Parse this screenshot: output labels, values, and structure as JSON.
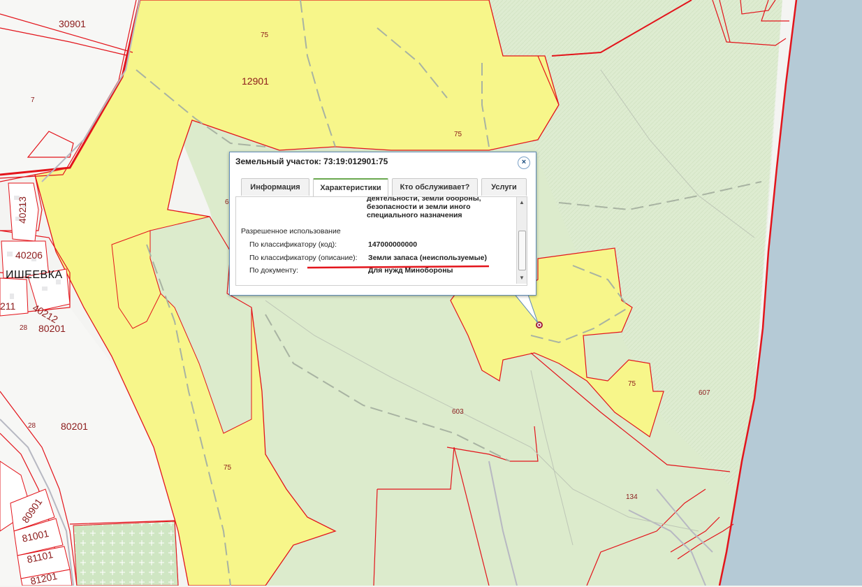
{
  "map": {
    "colors": {
      "background": "#f4f4f2",
      "green_area": "#dcebcc",
      "parcel_fill": "#f7f68a",
      "parcel_border": "#e3141b",
      "road": "#b5b5bb",
      "water": "#b5cad6",
      "park_green": "#cfe6c3"
    },
    "labels": {
      "l30901": "30901",
      "l12901": "12901",
      "l75a": "75",
      "l75b": "75",
      "l75c": "75",
      "l75d": "75",
      "l7": "7",
      "l40213": "40213",
      "l40206": "40206",
      "l40212": "40212",
      "l211": "211",
      "l28a": "28",
      "l80201a": "80201",
      "l28b": "28",
      "l80201b": "80201",
      "l603": "603",
      "l607": "607",
      "l134": "134",
      "l80901": "80901",
      "l81001": "81001",
      "l81101": "81101",
      "l81201": "81201",
      "l6": "6",
      "village": "ИШЕЕВКА"
    }
  },
  "popup": {
    "title": "Земельный участок: 73:19:012901:75",
    "close_symbol": "×",
    "tabs": [
      {
        "label": "Информация",
        "active": false
      },
      {
        "label": "Характеристики",
        "active": true
      },
      {
        "label": "Кто обслуживает?",
        "active": false
      },
      {
        "label": "Услуги",
        "active": false
      }
    ],
    "content": {
      "cut_line1": "деятельности, земли обороны,",
      "cut_line2": "безопасности и земли иного",
      "cut_line3": "специального назначения",
      "section": "Разрешенное использование",
      "rows": [
        {
          "label": "По классификатору (код):",
          "value": "147000000000"
        },
        {
          "label": "По классификатору (описание):",
          "value": "Земли запаса (неиспользуемые)"
        },
        {
          "label": "По документу:",
          "value": "Для нужд Минобороны"
        }
      ]
    },
    "scroll_up": "▲",
    "scroll_down": "▼"
  }
}
